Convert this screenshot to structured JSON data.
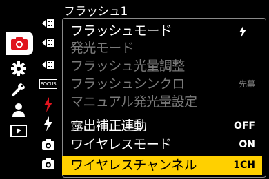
{
  "header": {
    "title": "フラッシュ1"
  },
  "main_tabs": [
    {
      "icon": "camera-icon",
      "active": true
    },
    {
      "icon": "gear-icon",
      "active": false
    },
    {
      "icon": "wrench-icon",
      "active": false
    },
    {
      "icon": "person-icon",
      "active": false
    },
    {
      "icon": "playback-icon",
      "active": false
    }
  ],
  "sub_tabs": [
    {
      "icon": "video-tab-icon"
    },
    {
      "icon": "video-tab-icon"
    },
    {
      "icon": "video-tab-icon"
    },
    {
      "icon": "focus-tab-icon",
      "text": "FOCUS"
    },
    {
      "icon": "flash-tab-icon",
      "active": true
    },
    {
      "icon": "flash-tab-icon"
    },
    {
      "icon": "camera-small-tab-icon"
    },
    {
      "icon": "camera-small-tab-icon"
    }
  ],
  "menu": {
    "items": [
      {
        "label": "フラッシュモード",
        "value": "",
        "value_icon": "flash-auto-icon",
        "state": "enabled"
      },
      {
        "label": "発光モード",
        "value": "",
        "state": "disabled"
      },
      {
        "label": "フラッシュ光量調整",
        "value": "",
        "state": "disabled"
      },
      {
        "label": "フラッシュシンクロ",
        "value": "先幕",
        "state": "disabled"
      },
      {
        "label": "マニュアル発光量設定",
        "value": "",
        "state": "disabled"
      },
      {
        "label": "露出補正連動",
        "value": "OFF",
        "state": "enabled"
      },
      {
        "label": "ワイヤレスモード",
        "value": "ON",
        "state": "enabled"
      },
      {
        "label": "ワイヤレスチャンネル",
        "value": "1CH",
        "state": "selected"
      }
    ]
  },
  "colors": {
    "background": "#000000",
    "selection": "#ffd000",
    "accent_red": "#e0141e",
    "disabled_text": "#7a7a7a",
    "panel_border": "#8a8a8a"
  }
}
